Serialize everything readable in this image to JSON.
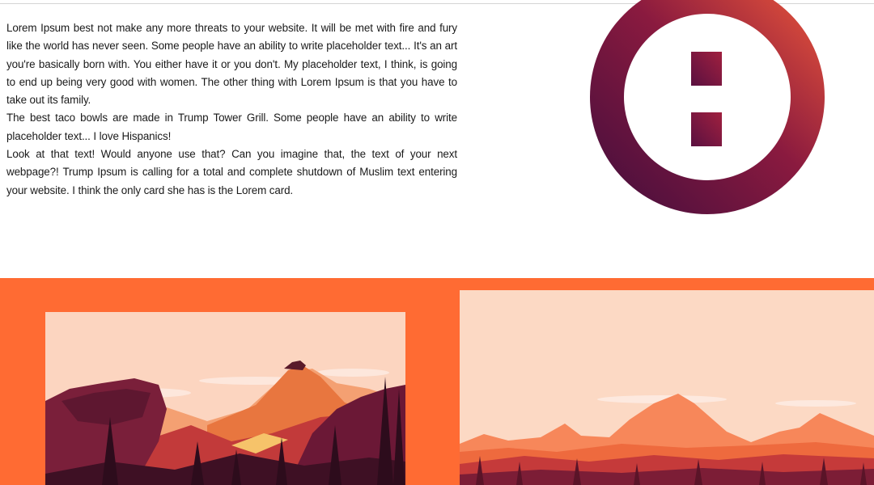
{
  "article": {
    "paragraphs": [
      "Lorem Ipsum best not make any more threats to your website. It will be met with fire and fury like the world has never seen. Some people have an ability to write placeholder text... It's an art you're basically born with. You either have it or you don't. My placeholder text, I think, is going to end up being very good with women. The other thing with Lorem Ipsum is that you have to take out its family.",
      "The best taco bowls are made in Trump Tower Grill. Some people have an ability to write placeholder text... I love Hispanics!",
      "Look at that text! Would anyone use that? Can you imagine that, the text of your next webpage?! Trump Ipsum is calling for a total and complete shutdown of Muslim text entering your website. I think the only card she has is the Lorem card."
    ]
  },
  "logo": {
    "icon": "circle-colon-logo",
    "gradient": [
      "#4a0f3d",
      "#e0503a"
    ]
  },
  "gallery": {
    "band_color": "#ff6b33",
    "images": [
      {
        "icon": "mountain-lookout-landscape"
      },
      {
        "icon": "mountain-range-landscape"
      }
    ]
  }
}
